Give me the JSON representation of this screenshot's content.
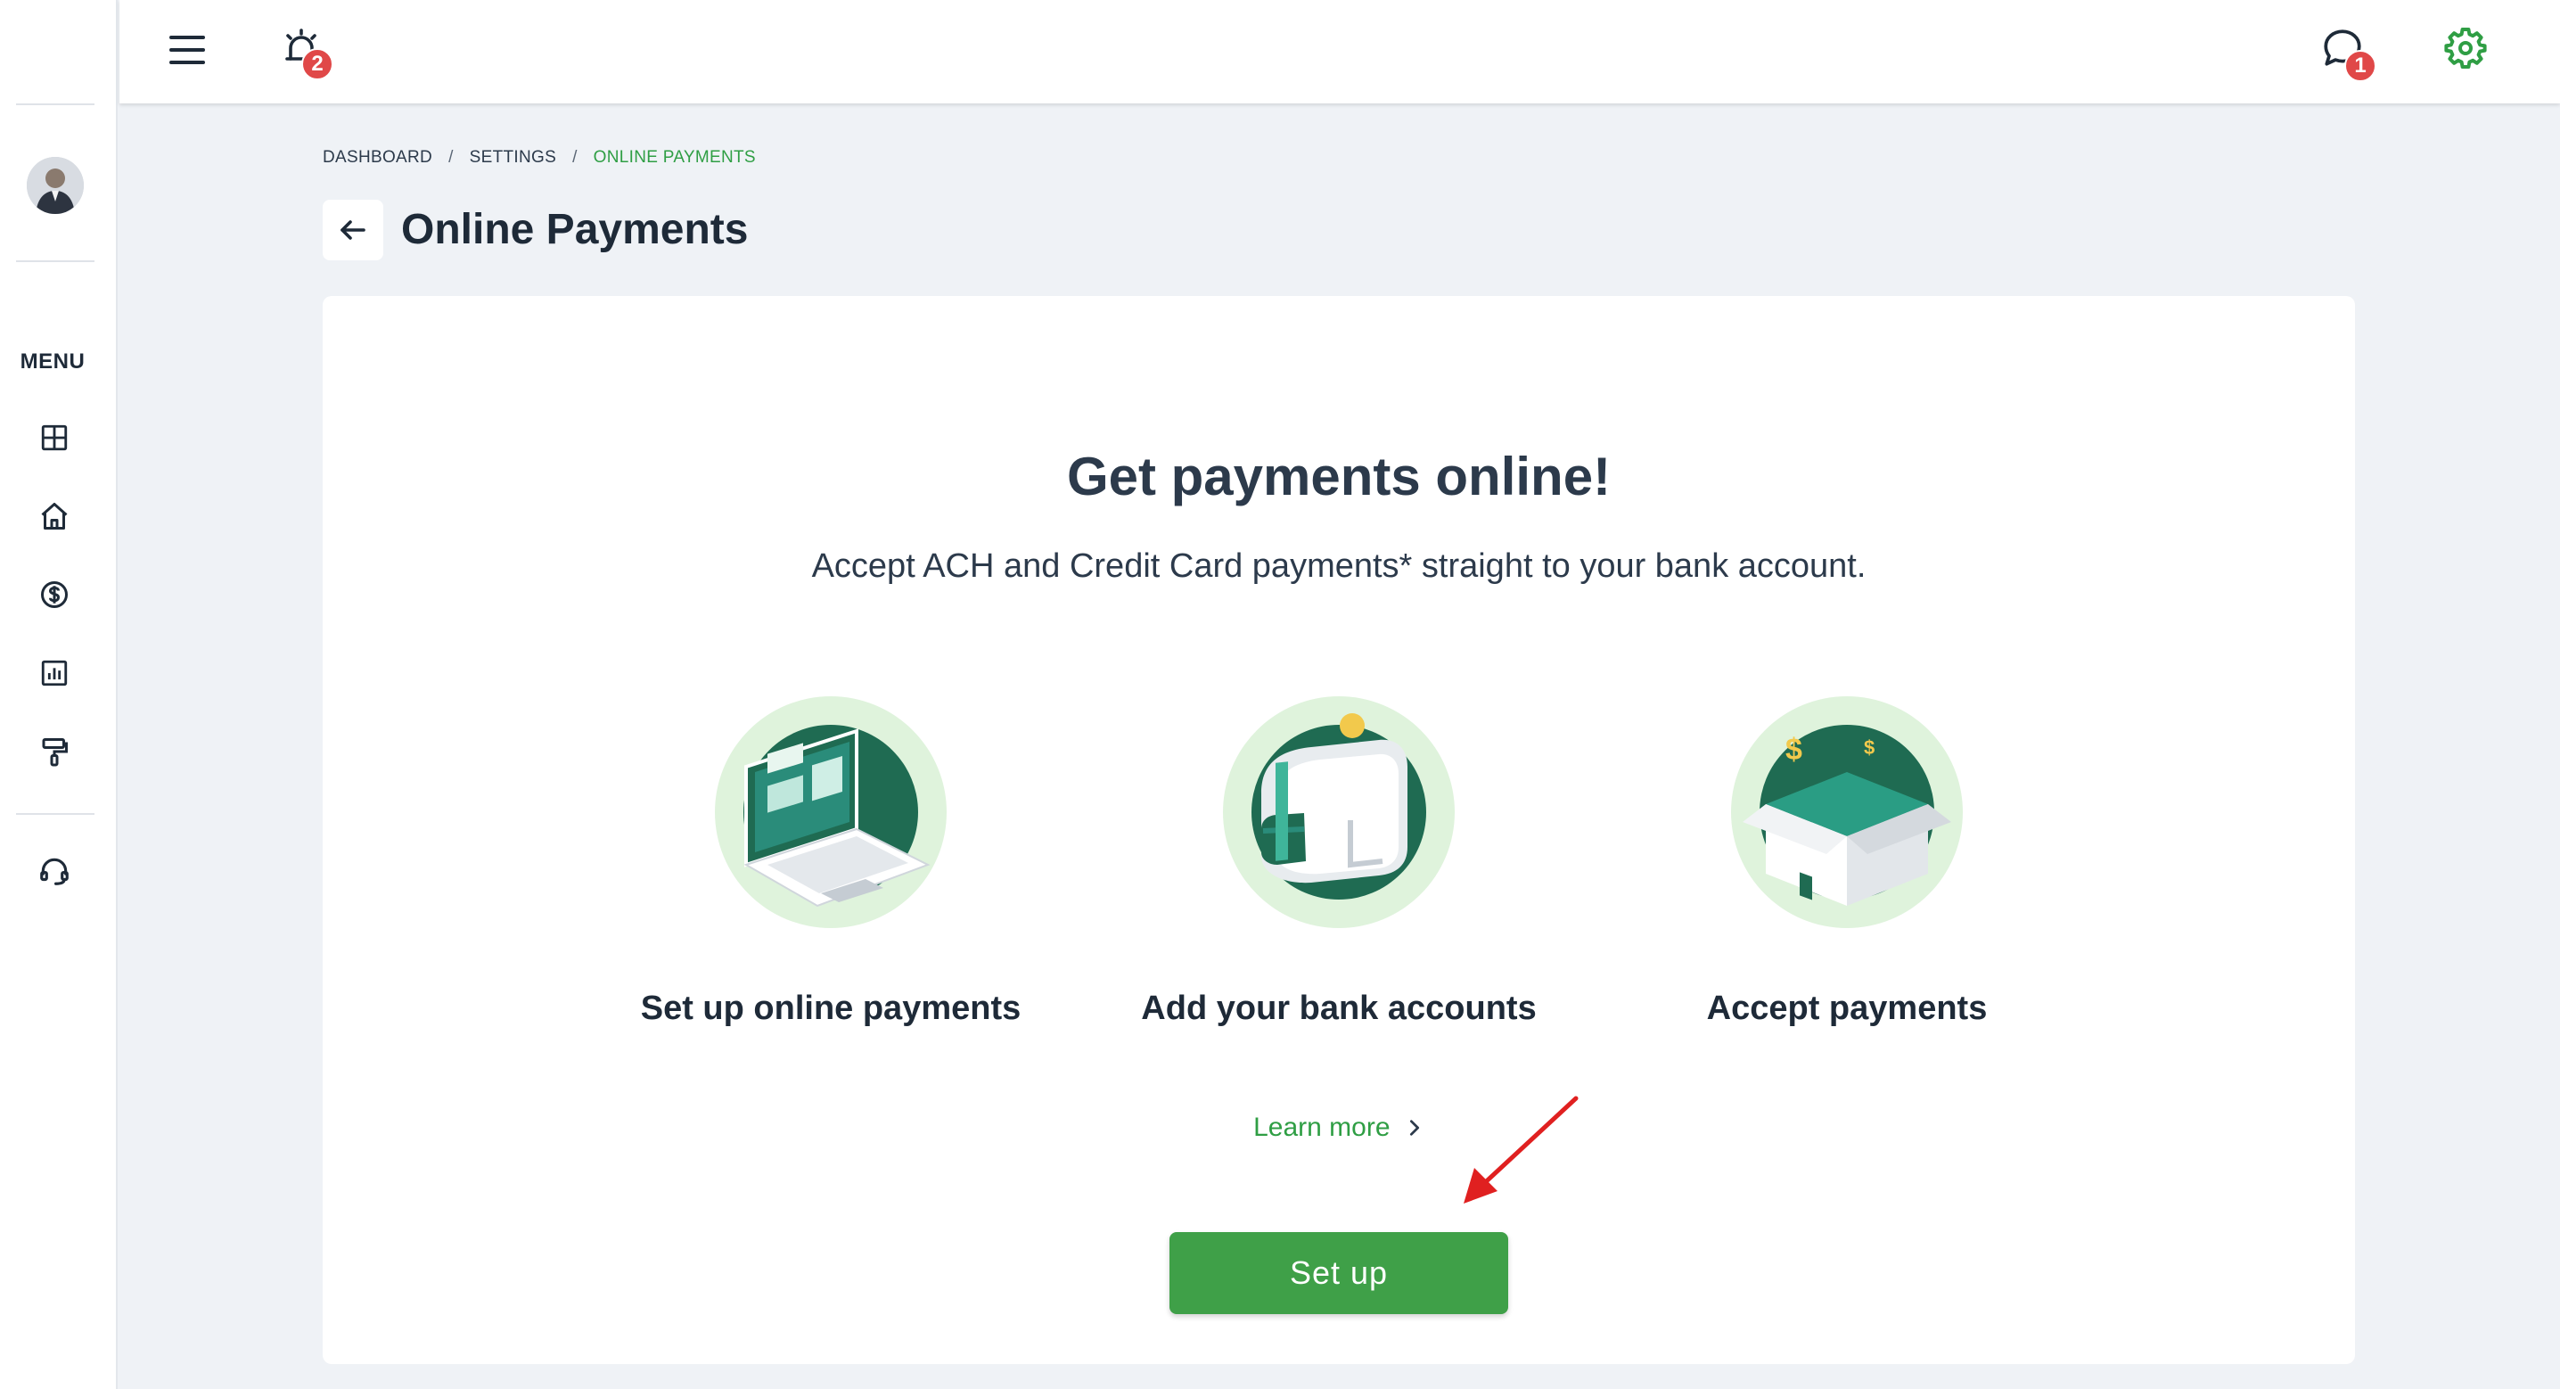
{
  "sidebar": {
    "menu_label": "MENU",
    "items": [
      {
        "icon": "dashboard-grid-icon"
      },
      {
        "icon": "home-icon"
      },
      {
        "icon": "dollar-icon"
      },
      {
        "icon": "bar-chart-icon"
      },
      {
        "icon": "paint-roller-icon"
      },
      {
        "icon": "headset-support-icon"
      }
    ]
  },
  "topbar": {
    "alarm_badge": "2",
    "chat_badge": "1",
    "accent_color": "#2f9e44",
    "badge_color": "#e04848"
  },
  "breadcrumb": {
    "items": [
      "DASHBOARD",
      "SETTINGS",
      "ONLINE PAYMENTS"
    ],
    "separator": "/"
  },
  "page": {
    "title": "Online Payments"
  },
  "card": {
    "headline": "Get payments online!",
    "subline": "Accept ACH and Credit Card payments* straight to your bank account.",
    "steps": [
      {
        "label": "Set up online payments",
        "icon": "laptop-illustration-icon"
      },
      {
        "label": "Add your bank accounts",
        "icon": "wallet-illustration-icon"
      },
      {
        "label": "Accept payments",
        "icon": "box-illustration-icon"
      }
    ],
    "learn_more": "Learn more",
    "setup_button": "Set up"
  }
}
